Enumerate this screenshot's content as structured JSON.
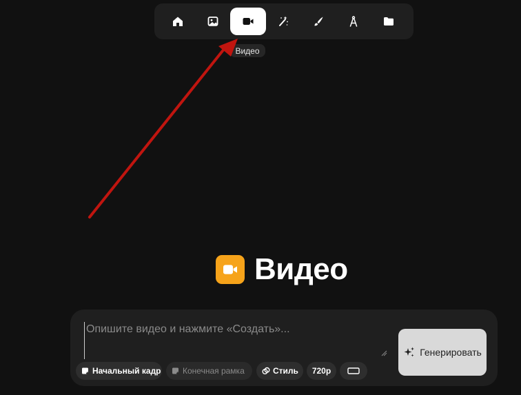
{
  "toolbar": {
    "items": [
      {
        "icon": "home-icon"
      },
      {
        "icon": "image-icon"
      },
      {
        "icon": "video-icon",
        "active": true
      },
      {
        "icon": "magic-wand-icon"
      },
      {
        "icon": "brush-icon"
      },
      {
        "icon": "compass-icon"
      },
      {
        "icon": "folder-icon"
      }
    ],
    "tooltip": "Видео"
  },
  "hero": {
    "title": "Видео",
    "icon": "video-icon",
    "icon_color": "#f6a31a"
  },
  "composer": {
    "placeholder": "Опишите видео и нажмите «Создать»...",
    "chips": {
      "start_frame": "Начальный кадр",
      "end_frame": "Конечная рамка",
      "style": "Стиль",
      "resolution": "720p",
      "aspect_icon": "aspect-ratio-icon"
    },
    "generate_label": "Генерировать"
  },
  "annotation": {
    "arrow_color": "#c0150f"
  }
}
